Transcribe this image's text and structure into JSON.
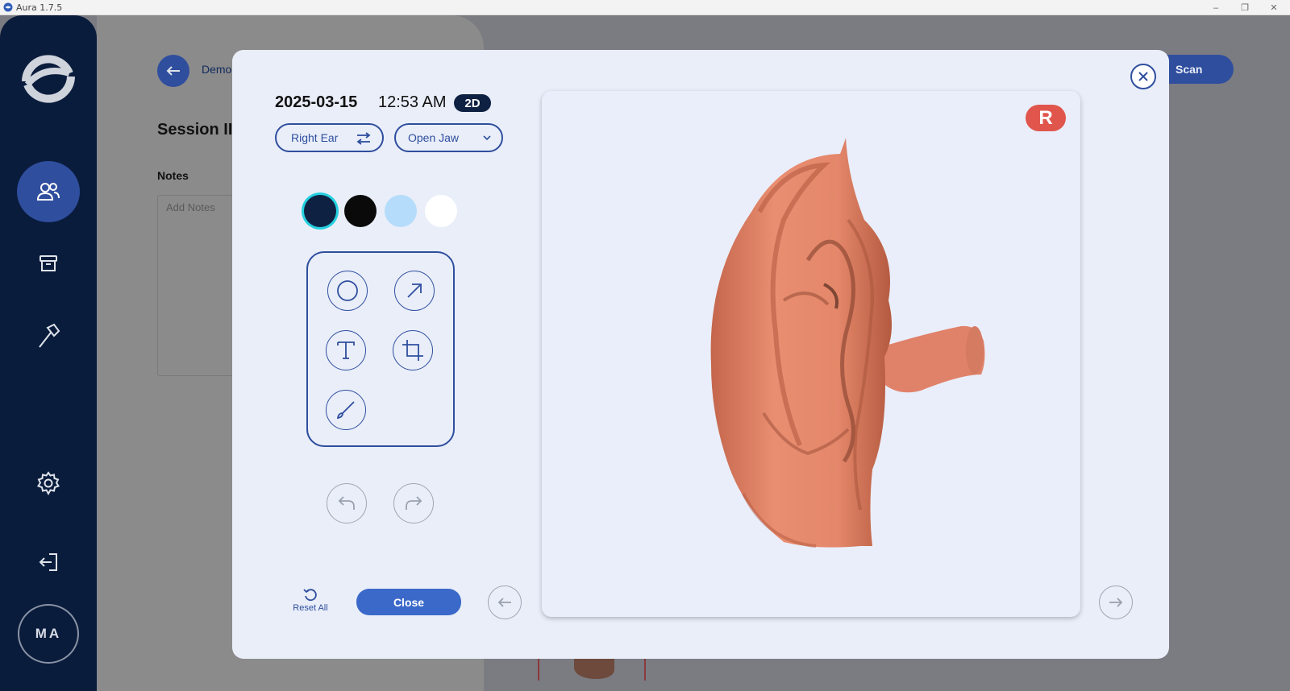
{
  "window": {
    "title": "Aura 1.7.5"
  },
  "sidebar": {
    "items": [
      {
        "name": "patients",
        "icon": "users-icon",
        "active": true
      },
      {
        "name": "archive",
        "icon": "archive-icon",
        "active": false
      },
      {
        "name": "tools",
        "icon": "hammer-icon",
        "active": false
      },
      {
        "name": "settings",
        "icon": "gear-icon",
        "active": false
      },
      {
        "name": "logout",
        "icon": "logout-icon",
        "active": false
      }
    ],
    "avatar_initials": "MA"
  },
  "background": {
    "breadcrumb": "Demo",
    "section_title": "Session II",
    "notes_label": "Notes",
    "notes_placeholder": "Add Notes",
    "scan_button": "Scan"
  },
  "modal": {
    "date": "2025-03-15",
    "time": "12:53 AM",
    "mode_badge": "2D",
    "side_selector": "Right Ear",
    "jaw_selector": "Open Jaw",
    "colors": [
      "#0f2142",
      "#0a0a0a",
      "#b5dcfb",
      "#ffffff"
    ],
    "selected_color_index": 0,
    "tools": [
      {
        "name": "circle-tool",
        "icon": "circle-icon"
      },
      {
        "name": "arrow-tool",
        "icon": "arrow-up-right-icon"
      },
      {
        "name": "text-tool",
        "icon": "text-icon"
      },
      {
        "name": "crop-tool",
        "icon": "crop-icon"
      },
      {
        "name": "brush-tool",
        "icon": "brush-icon"
      }
    ],
    "reset_label": "Reset All",
    "close_label": "Close",
    "side_badge": "R"
  },
  "colors": {
    "sidebar_bg": "#0a1c3c",
    "accent": "#2f4e9e",
    "primary_button": "#3b69c9",
    "side_badge": "#e0554c",
    "ear_model": "#e4876a"
  }
}
